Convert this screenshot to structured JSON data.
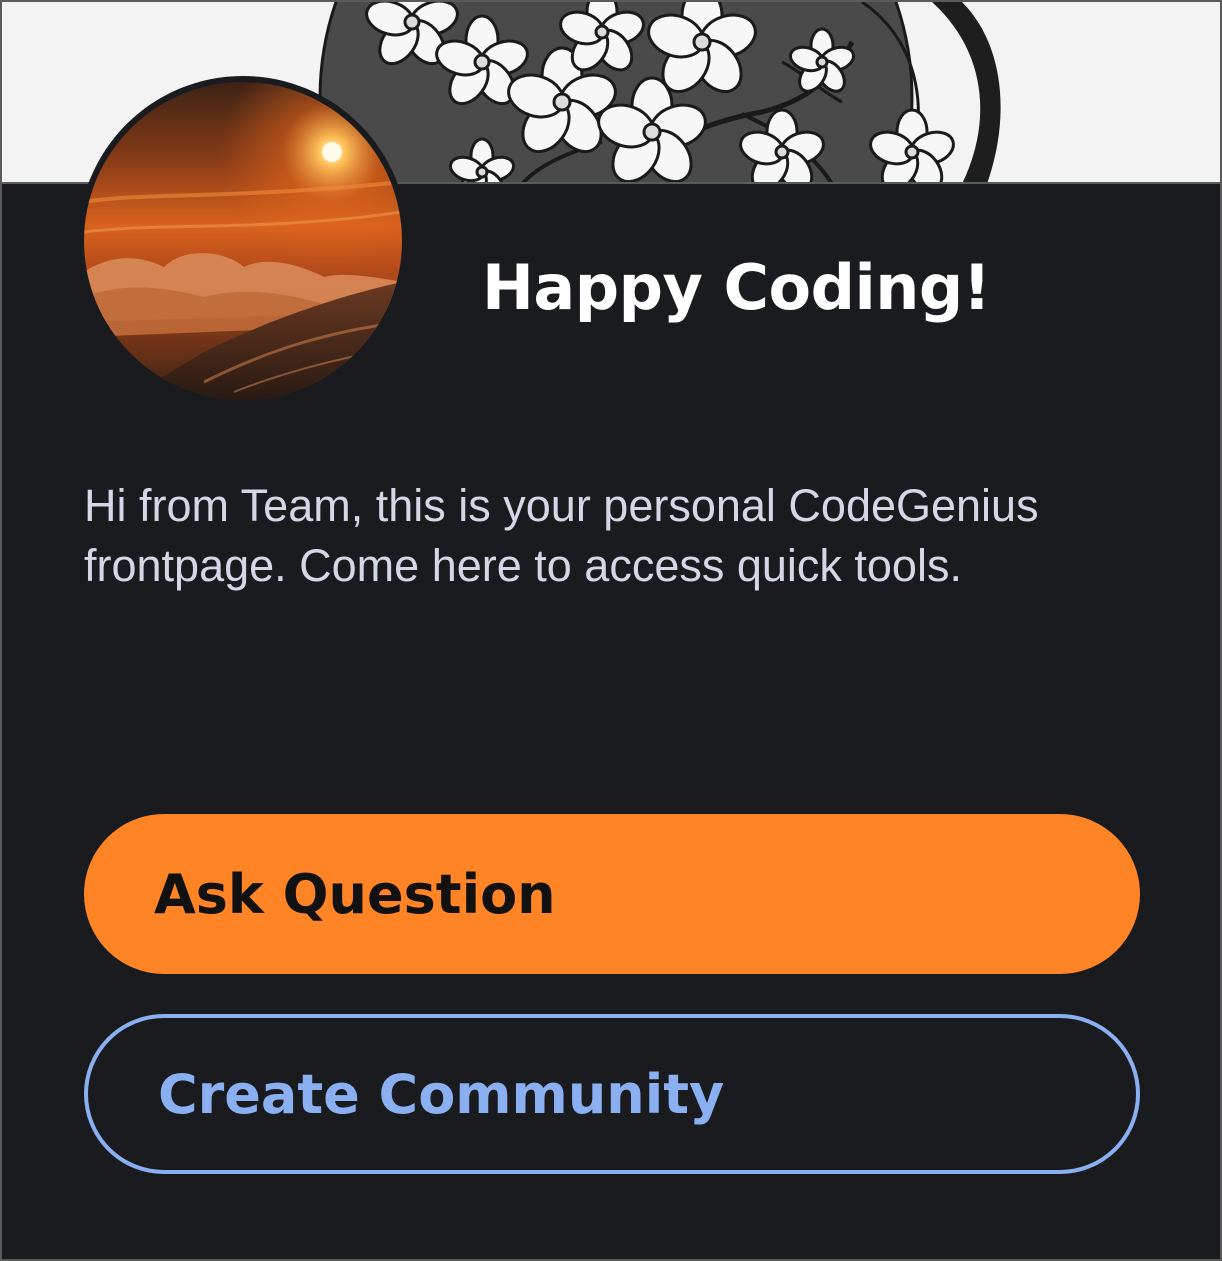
{
  "banner": {
    "image_name": "cherry-blossom-vase-illustration"
  },
  "avatar": {
    "image_name": "sunset-over-clouds-mountain-photo"
  },
  "card": {
    "title": "Happy Coding!",
    "description": "Hi from Team, this is your personal CodeGenius frontpage. Come here to access quick tools."
  },
  "actions": {
    "ask_question_label": "Ask Question",
    "create_community_label": "Create Community"
  },
  "colors": {
    "card_background": "#1a1b1e",
    "primary_button": "#ff8426",
    "secondary_accent": "#8ab0f2",
    "title_text": "#ffffff",
    "body_text": "#d4d8e6"
  }
}
